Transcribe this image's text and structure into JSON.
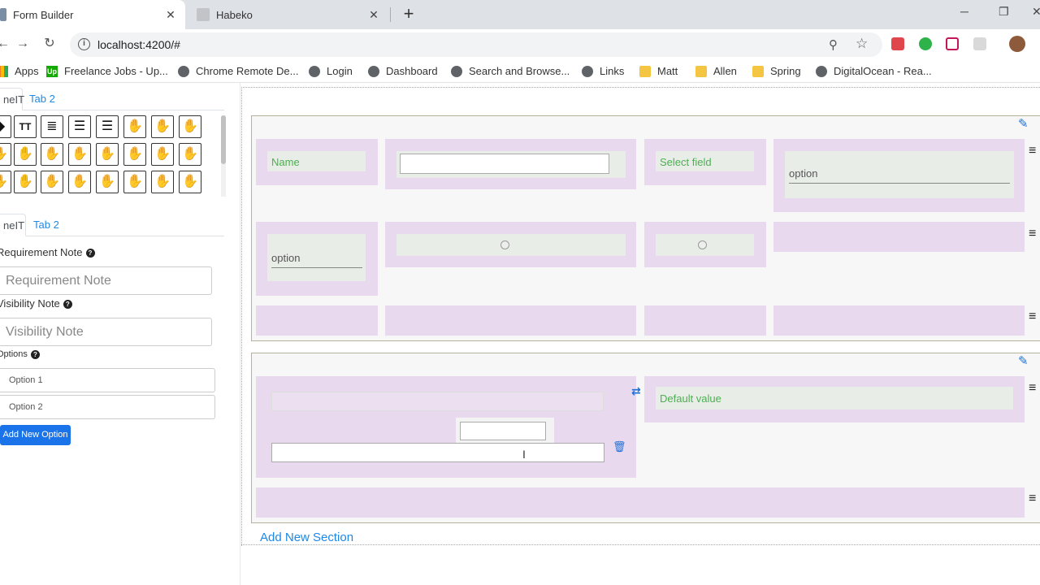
{
  "browser": {
    "tabs": [
      {
        "title": "Form Builder",
        "active": true
      },
      {
        "title": "Habeko",
        "active": false
      }
    ],
    "url": "localhost:4200/#",
    "bookmarks": [
      "Apps",
      "Freelance Jobs - Up...",
      "Chrome Remote De...",
      "Login",
      "Dashboard",
      "Search and Browse...",
      "Links",
      "Matt",
      "Allen",
      "Spring",
      "DigitalOcean - Rea..."
    ]
  },
  "left_panel": {
    "top_tabs": [
      "neIT",
      "Tab 2"
    ],
    "bottom_tabs": [
      "neIT",
      "Tab 2"
    ],
    "fields": {
      "requirement_label": "Requirement Note",
      "requirement_placeholder": "Requirement Note",
      "visibility_label": "Visibility Note",
      "visibility_placeholder": "Visibility Note",
      "options_label": "Options"
    },
    "options": [
      "Option 1",
      "Option 2"
    ],
    "add_option": "Add New Option"
  },
  "canvas": {
    "section1": {
      "name_label": "Name",
      "select_label": "Select field",
      "select_option": "option",
      "row2_option": "option"
    },
    "section2": {
      "default_label": "Default value"
    },
    "add_section": "Add New Section"
  }
}
